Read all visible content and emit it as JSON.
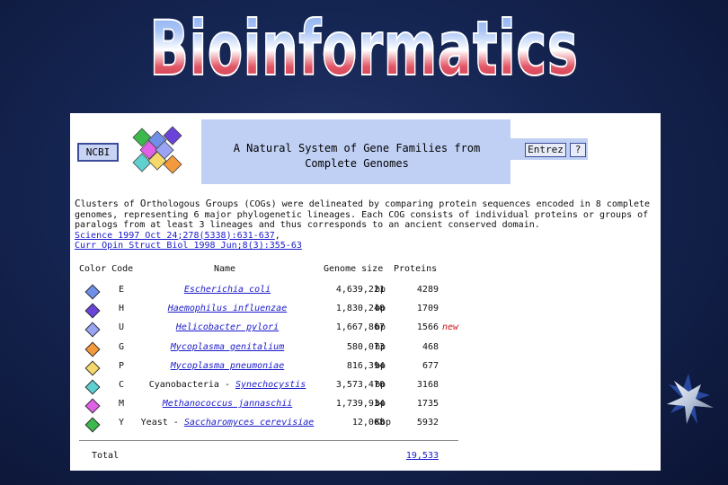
{
  "slide_title": "Bioinformatics",
  "ncbi_button": "NCBI",
  "banner_title_line1": "A Natural System of Gene Families from",
  "banner_title_line2": "Complete Genomes",
  "entrez_button": "Entrez",
  "help_button": "?",
  "intro": {
    "line1_start": "C",
    "line1_a": "lusters of ",
    "line1_o": "O",
    "line1_b": "rthologous ",
    "line1_g": "G",
    "line1_c": "roups (COGs) were delineated by comparing protein sequences encoded in 8 complete",
    "line2": "genomes, representing 6 major phylogenetic lineages. Each COG consists of individual proteins or groups of",
    "line3": "paralogs from at least 3 lineages and thus corresponds to an ancient conserved domain.",
    "ref1": "Science 1997 Oct 24;278(5338):631-637",
    "ref1_suffix": ",",
    "ref2": "Curr Opin Struct Biol 1998 Jun;8(3):355-63"
  },
  "table_headers": {
    "color_code": "Color Code",
    "name": "Name",
    "genome_size": "Genome size",
    "proteins": "Proteins"
  },
  "rows": [
    {
      "color": "#6f8fe8",
      "code": "E",
      "prefix": "",
      "name": "Escherichia coli",
      "size": "4,639,221",
      "unit": "bp",
      "proteins": "4289",
      "tag": ""
    },
    {
      "color": "#6a44d8",
      "code": "H",
      "prefix": "",
      "name": "Haemophilus influenzae",
      "size": "1,830,240",
      "unit": "bp",
      "proteins": "1709",
      "tag": ""
    },
    {
      "color": "#9aa4f4",
      "code": "U",
      "prefix": "",
      "name": "Helicobacter pylori",
      "size": "1,667,867",
      "unit": "bp",
      "proteins": "1566",
      "tag": "new"
    },
    {
      "color": "#f29a3c",
      "code": "G",
      "prefix": "",
      "name": "Mycoplasma genitalium",
      "size": "580,073",
      "unit": "bp",
      "proteins": "468",
      "tag": ""
    },
    {
      "color": "#f4d86c",
      "code": "P",
      "prefix": "",
      "name": "Mycoplasma pneumoniae",
      "size": "816,394",
      "unit": "bp",
      "proteins": "677",
      "tag": ""
    },
    {
      "color": "#5ed0d0",
      "code": "C",
      "prefix": "Cyanobacteria - ",
      "name": "Synechocystis",
      "size": "3,573,470",
      "unit": "bp",
      "proteins": "3168",
      "tag": ""
    },
    {
      "color": "#e060e8",
      "code": "M",
      "prefix": "",
      "name": "Methanococcus jannaschii",
      "size": "1,739,934",
      "unit": "bp",
      "proteins": "1735",
      "tag": ""
    },
    {
      "color": "#3cb84c",
      "code": "Y",
      "prefix": "Yeast - ",
      "name": "Saccharomyces cerevisiae",
      "size": "12,068",
      "unit": "Kbp",
      "proteins": "5932",
      "tag": ""
    }
  ],
  "total_label": "Total",
  "total_value": "19,533"
}
